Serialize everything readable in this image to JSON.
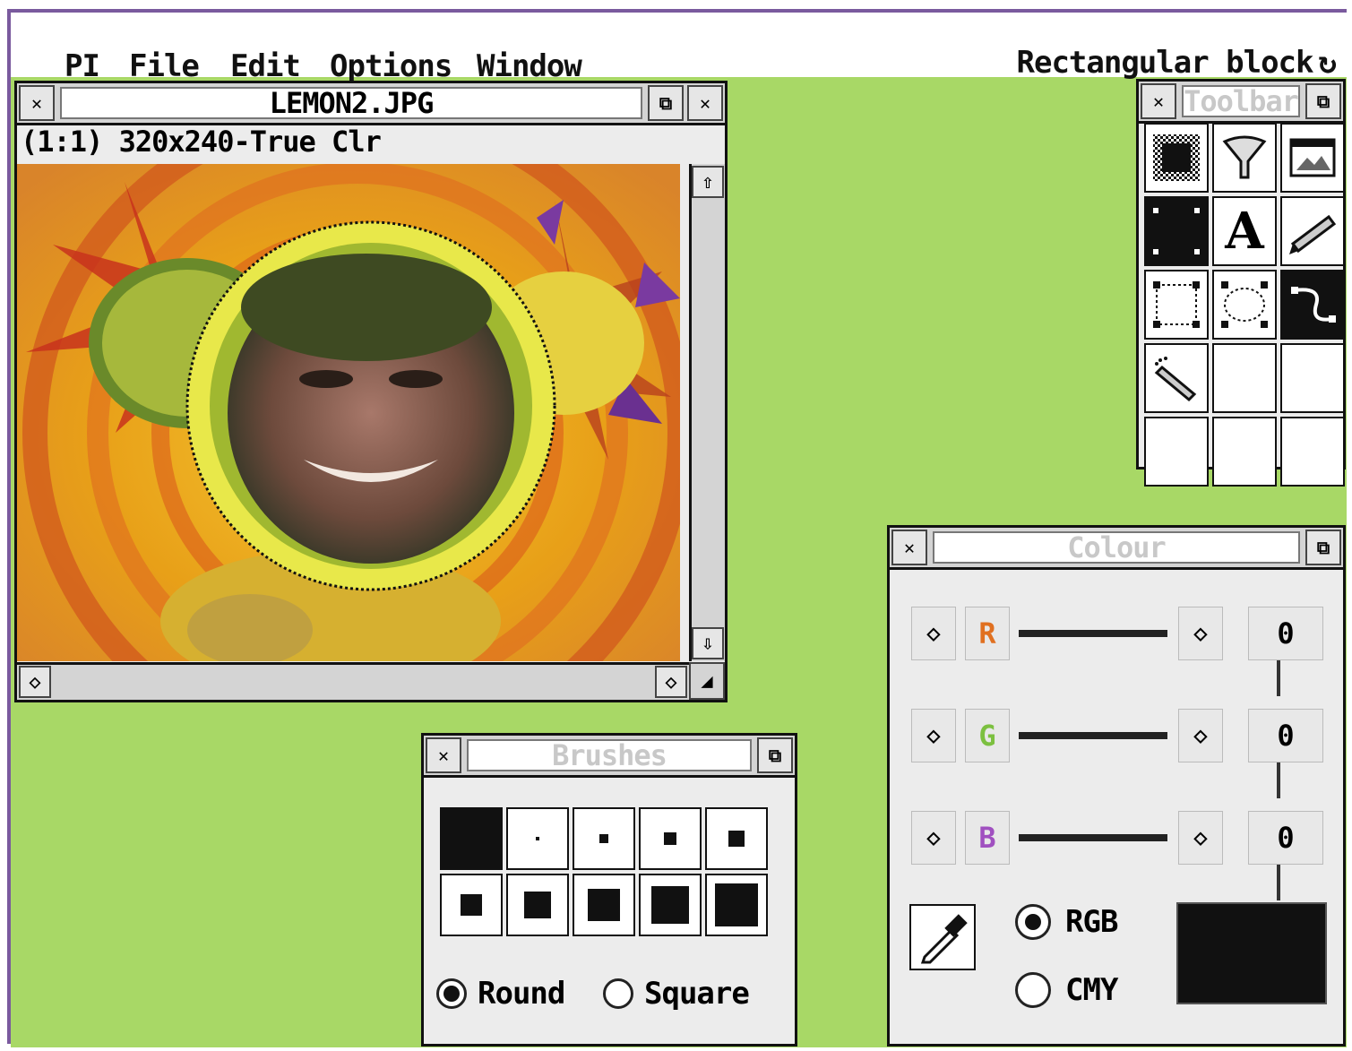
{
  "menubar": {
    "items": [
      "PI",
      "File",
      "Edit",
      "Options",
      "Window"
    ],
    "status_text": "Rectangular block"
  },
  "image_window": {
    "title": "LEMON2.JPG",
    "info": "(1:1) 320x240-True Clr"
  },
  "toolbar_window": {
    "title": "Toolbar",
    "tools": [
      "dither-pattern-icon",
      "funnel-icon",
      "image-icon",
      "fill-block-icon",
      "text-icon",
      "pencil-icon",
      "rect-select-icon",
      "ellipse-select-icon",
      "curve-icon",
      "airbrush-icon",
      "",
      "",
      "",
      "",
      ""
    ]
  },
  "brushes_window": {
    "title": "Brushes",
    "sizes": [
      1,
      2,
      4,
      6,
      8,
      10,
      12,
      14,
      16,
      18
    ],
    "shape_round": "Round",
    "shape_square": "Square",
    "selected_shape": "Round"
  },
  "colour_window": {
    "title": "Colour",
    "channels": [
      {
        "label": "R",
        "value": "0",
        "color": "#e07020"
      },
      {
        "label": "G",
        "value": "0",
        "color": "#7cc040"
      },
      {
        "label": "B",
        "value": "0",
        "color": "#a050c0"
      }
    ],
    "mode_rgb": "RGB",
    "mode_cmy": "CMY",
    "selected_mode": "RGB",
    "swatch_color": "#111111"
  }
}
